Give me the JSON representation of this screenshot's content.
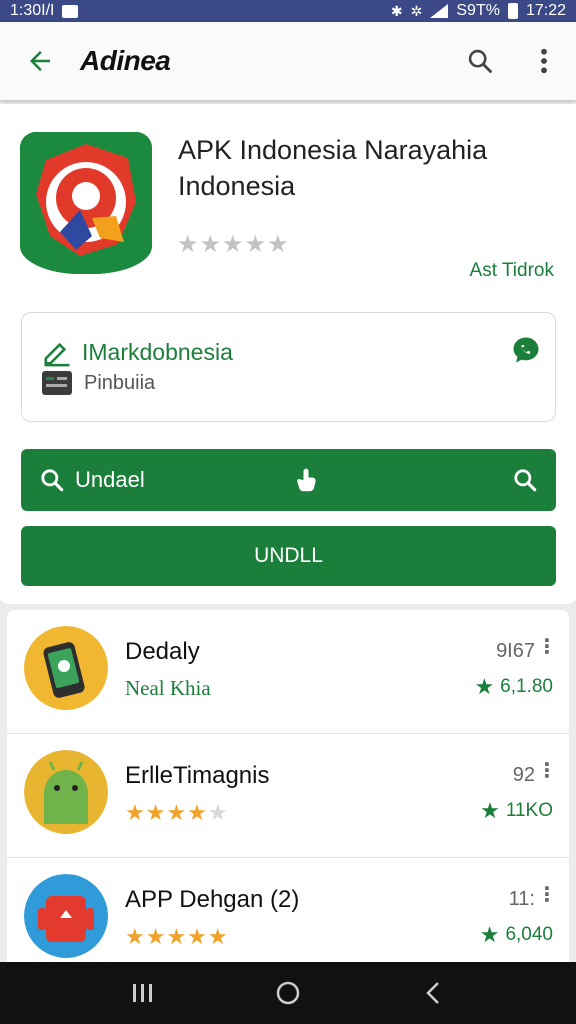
{
  "status_bar": {
    "time_left": "1:30I/I",
    "battery": "S9T%",
    "time_right": "17:22"
  },
  "appbar": {
    "title": "Adinea"
  },
  "app": {
    "name": "APK Indonesia Narayahia Indonesia",
    "rating_stars": 0,
    "developer_link": "Ast Tidrok"
  },
  "info": {
    "primary": "IMarkdobnesia",
    "secondary": "Pinbuiia"
  },
  "buttons": {
    "search_label": "Undael",
    "install_label": "UNDLL"
  },
  "list": [
    {
      "name": "Dedaly",
      "subtitle": "Neal Khia",
      "count": "9I67",
      "rating": "6,1.80",
      "stars": 0
    },
    {
      "name": "ErlleTimagnis",
      "subtitle": "",
      "count": "92",
      "rating": "11KO",
      "stars": 4.5
    },
    {
      "name": "APP Dehgan (2)",
      "subtitle": "",
      "count": "11:",
      "rating": "6,040",
      "stars": 5
    }
  ],
  "colors": {
    "accent": "#1b7f3b",
    "status_bar": "#3b4a86",
    "star": "#f1a22b"
  }
}
